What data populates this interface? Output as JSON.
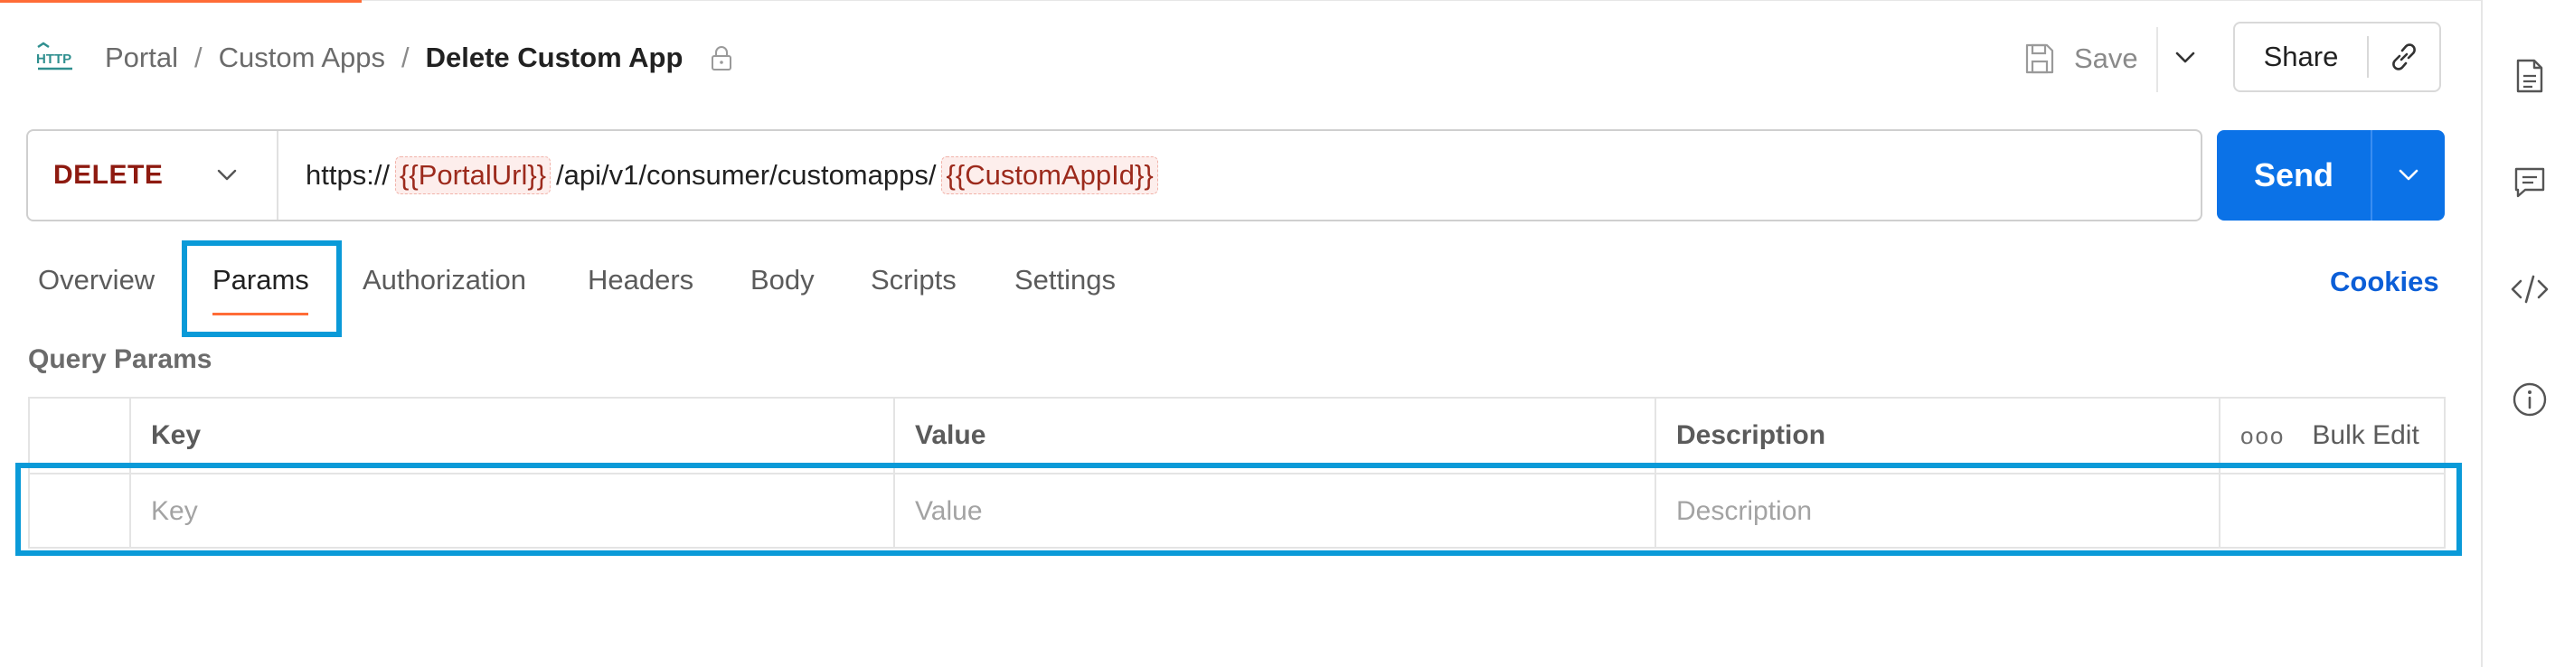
{
  "header": {
    "breadcrumbs": [
      "Portal",
      "Custom Apps"
    ],
    "separator": "/",
    "current": "Delete Custom App",
    "save_label": "Save",
    "share_label": "Share",
    "protocol_icon": "HTTP"
  },
  "request": {
    "method": "DELETE",
    "url_prefix": "https://",
    "var1": "{{PortalUrl}}",
    "url_middle": "/api/v1/consumer/customapps/",
    "var2": "{{CustomAppId}}",
    "send_label": "Send"
  },
  "tabs": [
    {
      "label": "Overview"
    },
    {
      "label": "Params",
      "active": true
    },
    {
      "label": "Authorization"
    },
    {
      "label": "Headers"
    },
    {
      "label": "Body"
    },
    {
      "label": "Scripts"
    },
    {
      "label": "Settings"
    }
  ],
  "cookies_label": "Cookies",
  "query_params": {
    "title": "Query Params",
    "headers": {
      "key": "Key",
      "value": "Value",
      "description": "Description",
      "bulk_edit": "Bulk Edit"
    },
    "placeholders": {
      "key": "Key",
      "value": "Value",
      "description": "Description"
    }
  },
  "colors": {
    "accent": "#ff6c37",
    "send": "#0b72e7",
    "method": "#8e1a10",
    "highlight": "#0a9ad8",
    "link": "#0b5ed7"
  },
  "icons": {
    "right_sidebar": [
      "document-icon",
      "comment-icon",
      "code-icon",
      "info-icon"
    ]
  }
}
